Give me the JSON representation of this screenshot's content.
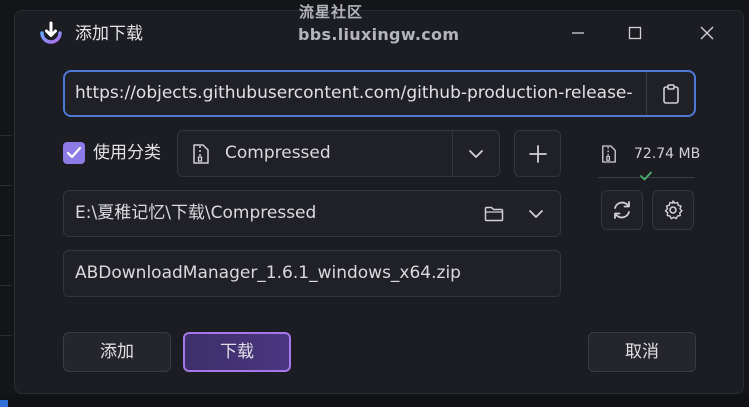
{
  "window": {
    "title": "添加下载",
    "watermark_line1": "流星社区",
    "watermark_line2": "bbs.liuxingw.com"
  },
  "url_field": {
    "value": "https://objects.githubusercontent.com/github-production-release-asse"
  },
  "category": {
    "checkbox_label": "使用分类",
    "checked": true,
    "selected": "Compressed"
  },
  "file_info": {
    "size": "72.74 MB"
  },
  "save_path": {
    "value": "E:\\夏稚记忆\\下载\\Compressed"
  },
  "file_name": {
    "value": "ABDownloadManager_1.6.1_windows_x64.zip"
  },
  "buttons": {
    "add": "添加",
    "download": "下载",
    "cancel": "取消"
  },
  "colors": {
    "accent": "#8d7ae6",
    "url_focus_border": "#4e78d6",
    "download_border": "#a478e8",
    "success": "#4caf6a"
  },
  "icons": [
    "app-logo-icon",
    "minimize-icon",
    "maximize-icon",
    "close-icon",
    "clipboard-icon",
    "checkbox-check-icon",
    "zip-file-icon",
    "chevron-down-icon",
    "plus-icon",
    "folder-icon",
    "refresh-icon",
    "gear-icon",
    "check-icon"
  ]
}
